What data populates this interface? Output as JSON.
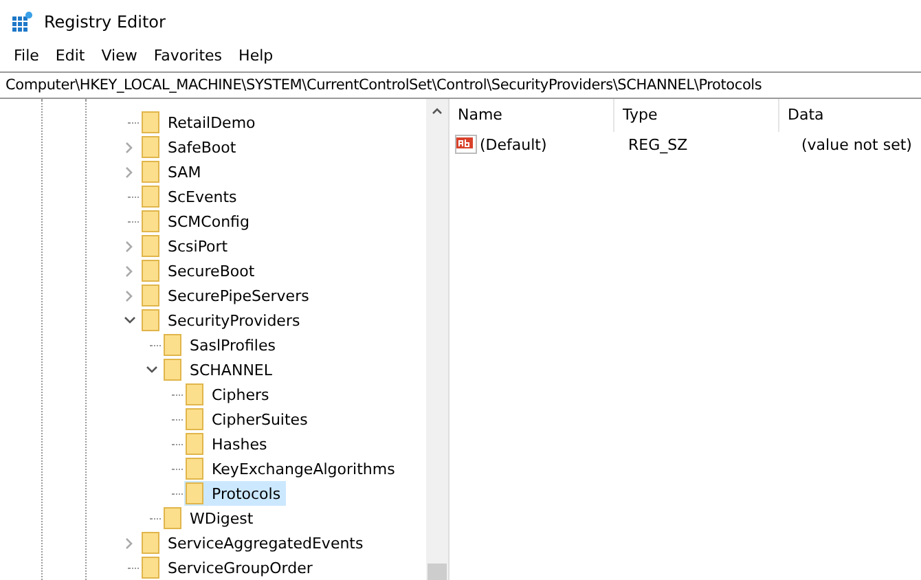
{
  "window": {
    "title": "Registry Editor"
  },
  "menu": [
    "File",
    "Edit",
    "View",
    "Favorites",
    "Help"
  ],
  "address": "Computer\\HKEY_LOCAL_MACHINE\\SYSTEM\\CurrentControlSet\\Control\\SecurityProviders\\SCHANNEL\\Protocols",
  "tree": [
    {
      "label": "RetailDemo",
      "kind": "leaf",
      "selected": false
    },
    {
      "label": "SafeBoot",
      "kind": "branch",
      "expanded": false,
      "selected": false
    },
    {
      "label": "SAM",
      "kind": "branch",
      "expanded": false,
      "selected": false
    },
    {
      "label": "ScEvents",
      "kind": "leaf",
      "selected": false
    },
    {
      "label": "SCMConfig",
      "kind": "leaf",
      "selected": false
    },
    {
      "label": "ScsiPort",
      "kind": "branch",
      "expanded": false,
      "selected": false
    },
    {
      "label": "SecureBoot",
      "kind": "branch",
      "expanded": false,
      "selected": false
    },
    {
      "label": "SecurePipeServers",
      "kind": "branch",
      "expanded": false,
      "selected": false
    },
    {
      "label": "SecurityProviders",
      "kind": "branch",
      "expanded": true,
      "selected": false,
      "children": [
        {
          "label": "SaslProfiles",
          "kind": "leaf",
          "selected": false
        },
        {
          "label": "SCHANNEL",
          "kind": "branch",
          "expanded": true,
          "selected": false,
          "children": [
            {
              "label": "Ciphers",
              "kind": "leaf",
              "selected": false
            },
            {
              "label": "CipherSuites",
              "kind": "leaf",
              "selected": false
            },
            {
              "label": "Hashes",
              "kind": "leaf",
              "selected": false
            },
            {
              "label": "KeyExchangeAlgorithms",
              "kind": "leaf",
              "selected": false
            },
            {
              "label": "Protocols",
              "kind": "leaf",
              "selected": true
            }
          ]
        },
        {
          "label": "WDigest",
          "kind": "leaf",
          "selected": false
        }
      ]
    },
    {
      "label": "ServiceAggregatedEvents",
      "kind": "branch",
      "expanded": false,
      "selected": false
    },
    {
      "label": "ServiceGroupOrder",
      "kind": "leaf",
      "selected": false
    }
  ],
  "values": {
    "columns": [
      "Name",
      "Type",
      "Data"
    ],
    "rows": [
      {
        "name": "(Default)",
        "type": "REG_SZ",
        "data": "(value not set)"
      }
    ]
  }
}
